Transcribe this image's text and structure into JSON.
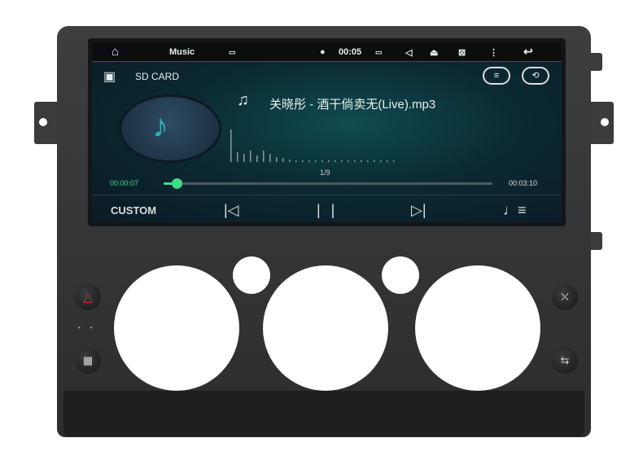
{
  "status_bar": {
    "home_icon": "home-icon",
    "app_title": "Music",
    "time": "00:05",
    "icons": [
      "image-icon",
      "location-icon",
      "battery-icon",
      "volume-icon",
      "eject-icon",
      "screen-off-icon",
      "more-icon",
      "back-icon"
    ]
  },
  "source": {
    "label": "SD CARD",
    "icon": "sd-card-icon"
  },
  "header_buttons": [
    "equalizer-icon",
    "repeat-icon"
  ],
  "track": {
    "title": "关晓彤 - 酒干倘卖无(Live).mp3",
    "position": "1/9",
    "elapsed": "00:00:07",
    "duration": "00:03:10",
    "progress_percent": 4
  },
  "controls": {
    "custom_label": "CUSTOM",
    "icons": [
      "previous-icon",
      "pause-icon",
      "next-icon",
      "playlist-icon"
    ]
  },
  "colors": {
    "accent": "#3ddc84",
    "screen_bg": "#0b2a33"
  },
  "hardware_buttons": [
    "hazard-button",
    "rear-defrost-button",
    "passenger-airbag-button",
    "air-recirculation-button"
  ]
}
